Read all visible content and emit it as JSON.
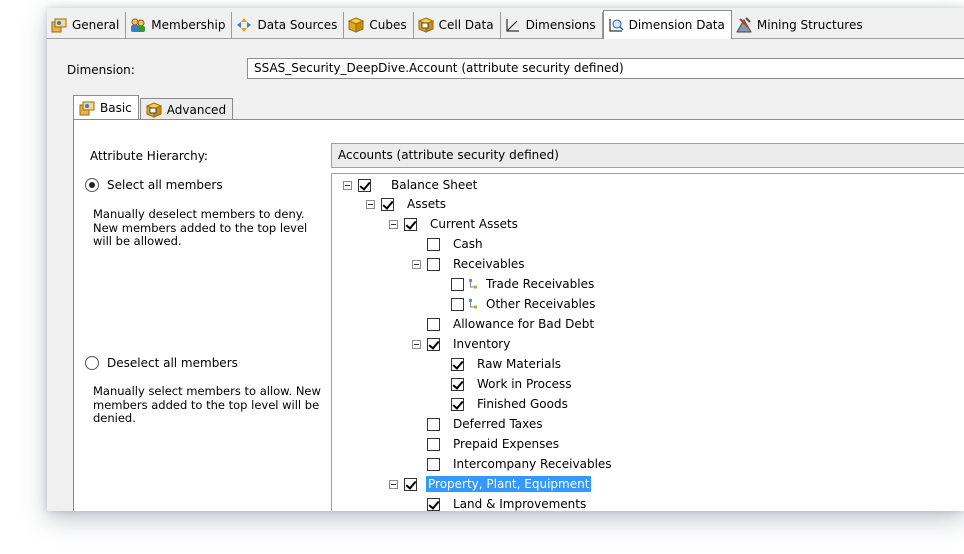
{
  "tabs": [
    {
      "label": "General",
      "icon": "general-icon"
    },
    {
      "label": "Membership",
      "icon": "membership-icon"
    },
    {
      "label": "Data Sources",
      "icon": "data-sources-icon"
    },
    {
      "label": "Cubes",
      "icon": "cube-icon"
    },
    {
      "label": "Cell Data",
      "icon": "cell-data-icon"
    },
    {
      "label": "Dimensions",
      "icon": "dimensions-icon"
    },
    {
      "label": "Dimension Data",
      "icon": "dimension-data-icon",
      "active": true
    },
    {
      "label": "Mining Structures",
      "icon": "mining-structures-icon"
    }
  ],
  "dimension": {
    "label": "Dimension:",
    "value": "SSAS_Security_DeepDive.Account (attribute security defined)"
  },
  "inner_tabs": {
    "basic": "Basic",
    "advanced": "Advanced"
  },
  "attribute_hierarchy": {
    "label": "Attribute Hierarchy:",
    "value": "Accounts (attribute security defined)"
  },
  "options": {
    "select_all": {
      "label": "Select all members",
      "selected": true,
      "description": "Manually deselect members to deny. New members added to the top level will be allowed."
    },
    "deselect_all": {
      "label": "Deselect all members",
      "selected": false,
      "description": "Manually select members to allow. New members added to the top level will be denied."
    }
  },
  "tree": [
    {
      "label": "Balance Sheet",
      "checked": true,
      "expander": true
    },
    {
      "label": "Assets",
      "checked": true,
      "expander": true
    },
    {
      "label": "Current Assets",
      "checked": true,
      "expander": true
    },
    {
      "label": "Cash",
      "checked": false,
      "expander": false
    },
    {
      "label": "Receivables",
      "checked": false,
      "expander": true
    },
    {
      "label": "Trade Receivables",
      "checked": false,
      "expander": false,
      "leaf_icon": true
    },
    {
      "label": "Other Receivables",
      "checked": false,
      "expander": false,
      "leaf_icon": true
    },
    {
      "label": "Allowance for Bad Debt",
      "checked": false,
      "expander": false
    },
    {
      "label": "Inventory",
      "checked": true,
      "expander": true
    },
    {
      "label": "Raw Materials",
      "checked": true,
      "expander": false
    },
    {
      "label": "Work in Process",
      "checked": true,
      "expander": false
    },
    {
      "label": "Finished Goods",
      "checked": true,
      "expander": false
    },
    {
      "label": "Deferred Taxes",
      "checked": false,
      "expander": false
    },
    {
      "label": "Prepaid Expenses",
      "checked": false,
      "expander": false
    },
    {
      "label": "Intercompany Receivables",
      "checked": false,
      "expander": false
    },
    {
      "label": "Property, Plant, Equipment",
      "checked": true,
      "expander": true,
      "selected": true
    },
    {
      "label": "Land & Improvements",
      "checked": true,
      "expander": false
    }
  ]
}
